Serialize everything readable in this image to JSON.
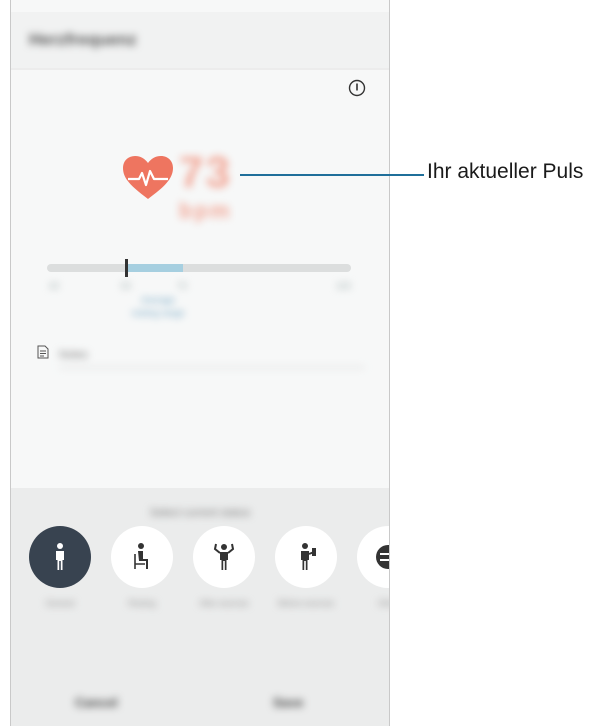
{
  "appbar": {
    "title": "Herzfrequenz"
  },
  "heart_rate": {
    "value": "73",
    "unit": "bpm"
  },
  "range": {
    "ticks": [
      "40",
      "50",
      "70",
      "100"
    ],
    "caption_line1": "Average",
    "caption_line2": "resting range",
    "marker_value": 50,
    "fill_to": 70
  },
  "notes": {
    "placeholder": "Notes"
  },
  "status": {
    "title": "Select current status",
    "items": [
      {
        "label": "General",
        "icon": "standing-person-icon",
        "selected": true
      },
      {
        "label": "Resting",
        "icon": "sitting-person-icon",
        "selected": false
      },
      {
        "label": "After exercise",
        "icon": "flexing-person-icon",
        "selected": false
      },
      {
        "label": "Before exercise",
        "icon": "person-with-dumbbell-icon",
        "selected": false
      },
      {
        "label": "Other",
        "icon": "partial-icon",
        "selected": false
      }
    ]
  },
  "actions": {
    "cancel": "Cancel",
    "save": "Save"
  },
  "annotation": {
    "text": "Ihr aktueller Puls"
  },
  "colors": {
    "heart": "#ee7560",
    "selected_status": "#384350",
    "range_fill": "#a6cfe0",
    "annotation_line": "#1f6f9a"
  }
}
